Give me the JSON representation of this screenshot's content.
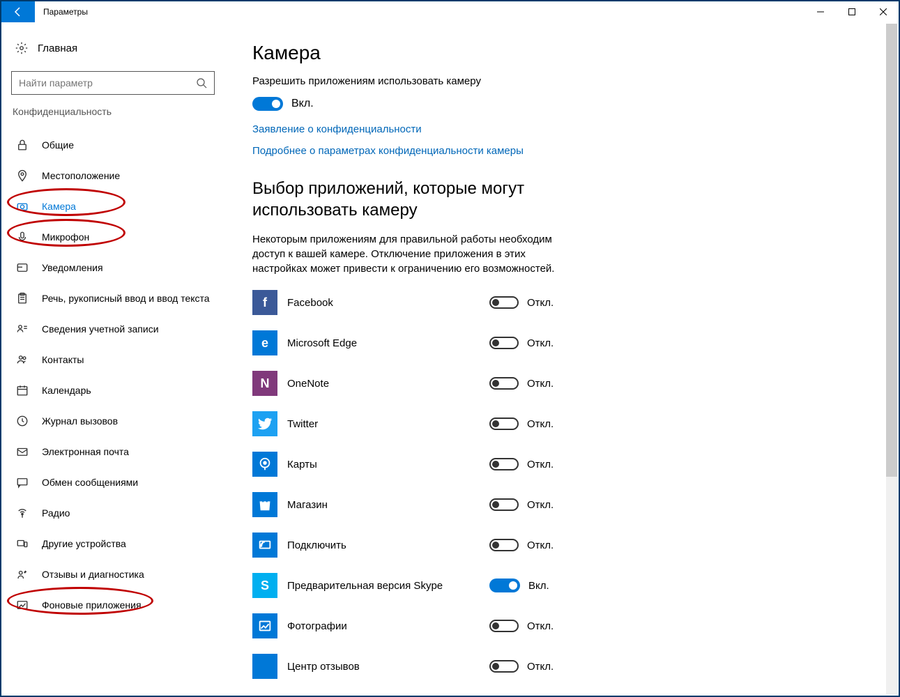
{
  "window": {
    "title": "Параметры"
  },
  "sidebar": {
    "home": "Главная",
    "search_placeholder": "Найти параметр",
    "category": "Конфиденциальность",
    "items": [
      {
        "label": "Общие"
      },
      {
        "label": "Местоположение"
      },
      {
        "label": "Камера"
      },
      {
        "label": "Микрофон"
      },
      {
        "label": "Уведомления"
      },
      {
        "label": "Речь, рукописный ввод и ввод текста"
      },
      {
        "label": "Сведения учетной записи"
      },
      {
        "label": "Контакты"
      },
      {
        "label": "Календарь"
      },
      {
        "label": "Журнал вызовов"
      },
      {
        "label": "Электронная почта"
      },
      {
        "label": "Обмен сообщениями"
      },
      {
        "label": "Радио"
      },
      {
        "label": "Другие устройства"
      },
      {
        "label": "Отзывы и диагностика"
      },
      {
        "label": "Фоновые приложения"
      }
    ]
  },
  "content": {
    "heading": "Камера",
    "allow_text": "Разрешить приложениям использовать камеру",
    "toggle_on_label": "Вкл.",
    "toggle_off_label": "Откл.",
    "link_privacy": "Заявление о конфиденциальности",
    "link_more": "Подробнее о параметрах конфиденциальности камеры",
    "choose_heading": "Выбор приложений, которые могут использовать камеру",
    "choose_desc": "Некоторым приложениям для правильной работы необходим доступ к вашей камере. Отключение приложения в этих настройках может привести к ограничению его возможностей.",
    "apps": [
      {
        "name": "Facebook",
        "on": false,
        "color": "#3b5998",
        "icon_text": "f"
      },
      {
        "name": "Microsoft Edge",
        "on": false,
        "color": "#0078d7",
        "icon_text": "e"
      },
      {
        "name": "OneNote",
        "on": false,
        "color": "#80397b",
        "icon_text": "N"
      },
      {
        "name": "Twitter",
        "on": false,
        "color": "#1da1f2",
        "icon_text": ""
      },
      {
        "name": "Карты",
        "on": false,
        "color": "#0078d7",
        "icon_text": ""
      },
      {
        "name": "Магазин",
        "on": false,
        "color": "#0078d7",
        "icon_text": ""
      },
      {
        "name": "Подключить",
        "on": false,
        "color": "#0078d7",
        "icon_text": ""
      },
      {
        "name": "Предварительная версия Skype",
        "on": true,
        "color": "#00aff0",
        "icon_text": "S"
      },
      {
        "name": "Фотографии",
        "on": false,
        "color": "#0078d7",
        "icon_text": ""
      },
      {
        "name": "Центр отзывов",
        "on": false,
        "color": "#0078d7",
        "icon_text": ""
      }
    ]
  }
}
